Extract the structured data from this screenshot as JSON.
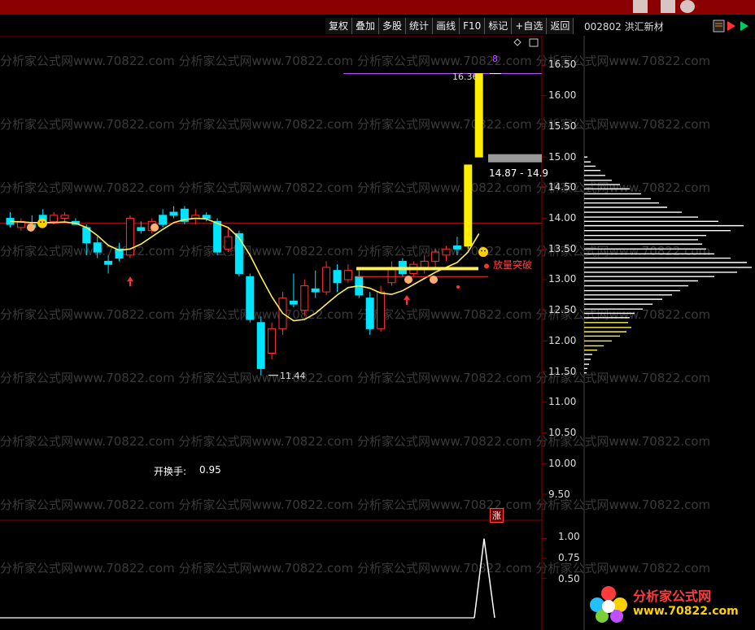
{
  "toolbar": {
    "items": [
      "复权",
      "叠加",
      "多股",
      "统计",
      "画线",
      "F10",
      "标记",
      "+自选",
      "返回"
    ]
  },
  "stock": {
    "code_name": "002802 洪汇新材"
  },
  "price_axis": {
    "ticks": [
      "16.50",
      "16.00",
      "15.50",
      "15.00",
      "14.50",
      "14.00",
      "13.50",
      "13.00",
      "12.50",
      "12.00",
      "11.50",
      "11.00",
      "10.50",
      "10.00",
      "9.50"
    ]
  },
  "volume_axis": {
    "ticks": [
      "1.00",
      "0.75",
      "0.50"
    ]
  },
  "annotations": {
    "high_label": "16.36",
    "low_label": "11.44",
    "range_label": "14.87 - 14.9",
    "top_number": "8",
    "breakout_label": "放量突破",
    "turnover_label": "开换手:",
    "turnover_value": "0.95",
    "limit_badge": "涨"
  },
  "watermark": {
    "repeat_text": "分析家公式网www.70822.com",
    "logo_text": "分析家公式网",
    "logo_url": "www.70822.com"
  },
  "colors": {
    "up": "#ff3333",
    "down": "#00e5ff",
    "ma": "#ffee55",
    "limit_up": "#ffee00",
    "grid": "#8b0000",
    "volume_profile": "#ffffff",
    "volume_profile_low": "#ffee55"
  },
  "chart_data": {
    "type": "candlestick",
    "y_range": [
      9.3,
      16.6
    ],
    "candles": [
      {
        "o": 14.0,
        "h": 14.1,
        "l": 13.85,
        "c": 13.9
      },
      {
        "o": 13.85,
        "h": 14.0,
        "l": 13.8,
        "c": 13.95
      },
      {
        "o": 13.9,
        "h": 14.05,
        "l": 13.8,
        "c": 13.85
      },
      {
        "o": 14.05,
        "h": 14.15,
        "l": 13.9,
        "c": 13.95
      },
      {
        "o": 13.95,
        "h": 14.1,
        "l": 13.9,
        "c": 14.05
      },
      {
        "o": 14.0,
        "h": 14.1,
        "l": 13.95,
        "c": 14.05
      },
      {
        "o": 13.95,
        "h": 14.0,
        "l": 13.9,
        "c": 13.9
      },
      {
        "o": 13.85,
        "h": 13.9,
        "l": 13.4,
        "c": 13.6
      },
      {
        "o": 13.6,
        "h": 13.7,
        "l": 13.35,
        "c": 13.45
      },
      {
        "o": 13.3,
        "h": 13.4,
        "l": 13.1,
        "c": 13.25
      },
      {
        "o": 13.5,
        "h": 13.6,
        "l": 13.3,
        "c": 13.35
      },
      {
        "o": 13.4,
        "h": 14.05,
        "l": 13.35,
        "c": 14.0
      },
      {
        "o": 13.85,
        "h": 13.95,
        "l": 13.75,
        "c": 13.8
      },
      {
        "o": 13.8,
        "h": 14.0,
        "l": 13.75,
        "c": 13.95
      },
      {
        "o": 14.05,
        "h": 14.15,
        "l": 13.85,
        "c": 13.9
      },
      {
        "o": 14.1,
        "h": 14.2,
        "l": 14.0,
        "c": 14.05
      },
      {
        "o": 14.15,
        "h": 14.2,
        "l": 13.9,
        "c": 13.95
      },
      {
        "o": 14.0,
        "h": 14.15,
        "l": 13.9,
        "c": 14.05
      },
      {
        "o": 14.05,
        "h": 14.1,
        "l": 13.95,
        "c": 14.0
      },
      {
        "o": 13.95,
        "h": 14.0,
        "l": 13.4,
        "c": 13.45
      },
      {
        "o": 13.5,
        "h": 13.85,
        "l": 13.45,
        "c": 13.7
      },
      {
        "o": 13.75,
        "h": 13.8,
        "l": 13.05,
        "c": 13.1
      },
      {
        "o": 13.05,
        "h": 13.1,
        "l": 12.3,
        "c": 12.35
      },
      {
        "o": 12.3,
        "h": 12.4,
        "l": 11.44,
        "c": 11.55
      },
      {
        "o": 11.8,
        "h": 12.3,
        "l": 11.7,
        "c": 12.2
      },
      {
        "o": 12.2,
        "h": 12.8,
        "l": 12.1,
        "c": 12.7
      },
      {
        "o": 12.65,
        "h": 13.1,
        "l": 12.55,
        "c": 12.6
      },
      {
        "o": 12.5,
        "h": 13.0,
        "l": 12.4,
        "c": 12.9
      },
      {
        "o": 12.85,
        "h": 13.15,
        "l": 12.7,
        "c": 12.8
      },
      {
        "o": 12.8,
        "h": 13.3,
        "l": 12.75,
        "c": 13.2
      },
      {
        "o": 13.15,
        "h": 13.25,
        "l": 12.8,
        "c": 12.95
      },
      {
        "o": 13.0,
        "h": 13.25,
        "l": 12.95,
        "c": 13.15
      },
      {
        "o": 13.05,
        "h": 13.15,
        "l": 12.7,
        "c": 12.75
      },
      {
        "o": 12.7,
        "h": 12.8,
        "l": 12.1,
        "c": 12.2
      },
      {
        "o": 12.2,
        "h": 12.9,
        "l": 12.15,
        "c": 12.8
      },
      {
        "o": 12.95,
        "h": 13.3,
        "l": 12.9,
        "c": 13.2
      },
      {
        "o": 13.3,
        "h": 13.35,
        "l": 13.05,
        "c": 13.1
      },
      {
        "o": 13.1,
        "h": 13.3,
        "l": 13.05,
        "c": 13.25
      },
      {
        "o": 13.2,
        "h": 13.4,
        "l": 13.1,
        "c": 13.3
      },
      {
        "o": 13.3,
        "h": 13.5,
        "l": 13.2,
        "c": 13.45
      },
      {
        "o": 13.4,
        "h": 13.55,
        "l": 13.3,
        "c": 13.5
      },
      {
        "o": 13.55,
        "h": 13.7,
        "l": 13.4,
        "c": 13.5
      },
      {
        "o": 13.55,
        "h": 14.87,
        "l": 13.5,
        "c": 14.87
      },
      {
        "o": 15.0,
        "h": 16.36,
        "l": 15.0,
        "c": 16.36
      }
    ],
    "ma": [
      13.95,
      13.94,
      13.93,
      13.93,
      13.93,
      13.94,
      13.92,
      13.85,
      13.72,
      13.56,
      13.48,
      13.5,
      13.58,
      13.7,
      13.82,
      13.93,
      13.98,
      14.0,
      13.99,
      13.92,
      13.85,
      13.68,
      13.4,
      13.05,
      12.72,
      12.45,
      12.33,
      12.35,
      12.45,
      12.6,
      12.75,
      12.87,
      12.9,
      12.86,
      12.78,
      12.76,
      12.82,
      12.92,
      13.02,
      13.12,
      13.2,
      13.28,
      13.45,
      13.75
    ],
    "volume_profile": [
      {
        "p": 15.0,
        "w": 4
      },
      {
        "p": 14.92,
        "w": 8
      },
      {
        "p": 14.85,
        "w": 14
      },
      {
        "p": 14.78,
        "w": 20
      },
      {
        "p": 14.7,
        "w": 26
      },
      {
        "p": 14.62,
        "w": 34
      },
      {
        "p": 14.55,
        "w": 44
      },
      {
        "p": 14.48,
        "w": 56
      },
      {
        "p": 14.4,
        "w": 70
      },
      {
        "p": 14.32,
        "w": 82
      },
      {
        "p": 14.25,
        "w": 92
      },
      {
        "p": 14.18,
        "w": 102
      },
      {
        "p": 14.1,
        "w": 120
      },
      {
        "p": 14.02,
        "w": 140
      },
      {
        "p": 13.95,
        "w": 165
      },
      {
        "p": 13.88,
        "w": 196
      },
      {
        "p": 13.8,
        "w": 180
      },
      {
        "p": 13.72,
        "w": 150
      },
      {
        "p": 13.65,
        "w": 140
      },
      {
        "p": 13.58,
        "w": 145
      },
      {
        "p": 13.5,
        "w": 150
      },
      {
        "p": 13.42,
        "w": 160
      },
      {
        "p": 13.35,
        "w": 180
      },
      {
        "p": 13.28,
        "w": 200
      },
      {
        "p": 13.2,
        "w": 206
      },
      {
        "p": 13.12,
        "w": 188
      },
      {
        "p": 13.05,
        "w": 160
      },
      {
        "p": 12.98,
        "w": 140
      },
      {
        "p": 12.9,
        "w": 128
      },
      {
        "p": 12.82,
        "w": 118
      },
      {
        "p": 12.75,
        "w": 108
      },
      {
        "p": 12.68,
        "w": 96
      },
      {
        "p": 12.6,
        "w": 84
      },
      {
        "p": 12.52,
        "w": 72
      },
      {
        "p": 12.45,
        "w": 62
      },
      {
        "p": 12.38,
        "w": 56
      },
      {
        "p": 12.3,
        "w": 54,
        "low": true
      },
      {
        "p": 12.22,
        "w": 58,
        "low": true
      },
      {
        "p": 12.15,
        "w": 52,
        "low": true
      },
      {
        "p": 12.08,
        "w": 44,
        "low": true
      },
      {
        "p": 12.0,
        "w": 34,
        "low": true
      },
      {
        "p": 11.92,
        "w": 24,
        "low": true
      },
      {
        "p": 11.85,
        "w": 16,
        "low": true
      },
      {
        "p": 11.78,
        "w": 10
      },
      {
        "p": 11.7,
        "w": 8
      },
      {
        "p": 11.62,
        "w": 6
      },
      {
        "p": 11.55,
        "w": 4
      },
      {
        "p": 11.48,
        "w": 3
      }
    ],
    "indicator": {
      "y_range": [
        0,
        1.15
      ],
      "values_tail": [
        0,
        0,
        1,
        0
      ]
    }
  }
}
